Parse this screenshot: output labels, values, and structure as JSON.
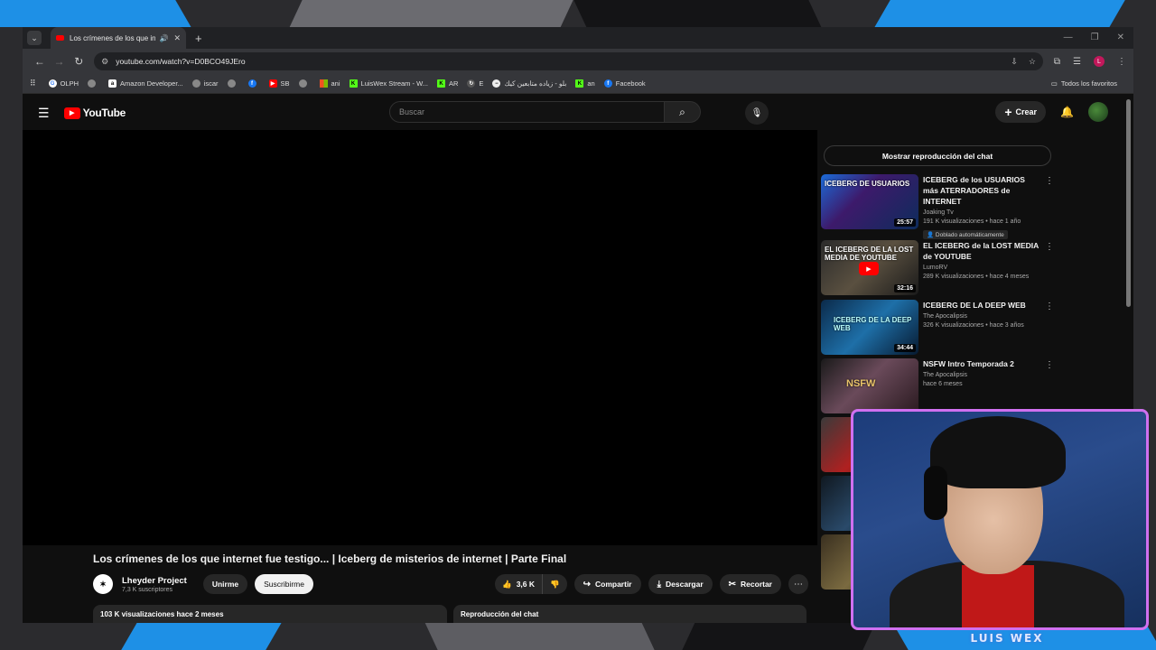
{
  "browser": {
    "tab_title": "Los crímenes de los que int",
    "url": "youtube.com/watch?v=D0BCO49JEro",
    "bookmarks": [
      "OLPH",
      "Amazon Developer...",
      "iscar",
      "SB",
      "ani",
      "LuisWex Stream - W...",
      "AR",
      "E",
      "بلو - زياده متابعين كيك",
      "an",
      "Facebook"
    ],
    "all_bookmarks": "Todos los favoritos",
    "profile_initial": "L"
  },
  "youtube": {
    "logo_text": "YouTube",
    "search_placeholder": "Buscar",
    "create_label": "Crear"
  },
  "video": {
    "title": "Los crímenes de los que internet fue testigo... | Iceberg de misterios de internet | Parte Final",
    "channel_name": "Lheyder Project",
    "subscribers": "7,3 K suscriptores",
    "join_label": "Unirme",
    "subscribe_label": "Suscribirme",
    "likes": "3,6 K",
    "share_label": "Compartir",
    "download_label": "Descargar",
    "clip_label": "Recortar",
    "views_date": "103 K visualizaciones  hace 2 meses",
    "chat_replay_bar": "Reproducción del chat"
  },
  "sidebar": {
    "chat_replay_button": "Mostrar reproducción del chat",
    "recommendations": [
      {
        "title": "ICEBERG de los USUARIOS más ATERRADORES de INTERNET",
        "channel": "Joaking Tv",
        "stats": "191 K visualizaciones • hace 1 año",
        "badge": "Doblado automáticamente",
        "duration": "25:57",
        "thumb_text": "ICEBERG DE USUARIOS"
      },
      {
        "title": "EL ICEBERG de la LOST MEDIA de YOUTUBE",
        "channel": "LumoRV",
        "stats": "289 K visualizaciones • hace 4 meses",
        "duration": "32:16",
        "thumb_text": "EL ICEBERG DE LA LOST MEDIA DE YOUTUBE"
      },
      {
        "title": "ICEBERG DE LA DEEP WEB",
        "channel": "The Apocalipsis",
        "stats": "326 K visualizaciones • hace 3 años",
        "duration": "34:44",
        "thumb_text": "ICEBERG DE LA DEEP WEB"
      },
      {
        "title": "NSFW Intro Temporada 2",
        "channel": "The Apocalipsis",
        "stats": "hace 6 meses",
        "thumb_text": "NSFW"
      }
    ]
  },
  "stream": {
    "streamer_name": "LUIS WEX"
  }
}
